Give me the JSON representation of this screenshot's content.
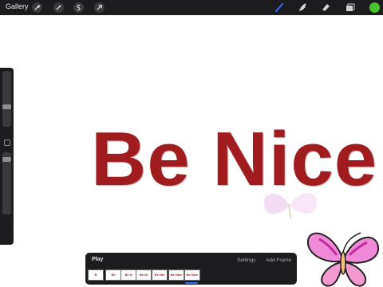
{
  "topbar": {
    "gallery_label": "Gallery",
    "left_tools": [
      "wrench-icon",
      "magic-wand-icon",
      "selection-icon",
      "transform-arrow-icon"
    ],
    "right_tools": [
      "brush-icon",
      "smudge-icon",
      "eraser-icon",
      "layers-icon"
    ],
    "active_tool": "brush-icon",
    "accent_color": "#2f6df6",
    "current_color": "#49c32c"
  },
  "sidebar": {
    "controls": [
      "brush-size-slider",
      "modify-button",
      "brush-opacity-slider"
    ]
  },
  "canvas": {
    "text": "Be Nice",
    "text_color": "#a11c1f"
  },
  "animation": {
    "play_label": "Play",
    "settings_label": "Settings",
    "add_frame_label": "Add Frame",
    "frames": [
      "B",
      "Be",
      "Be N",
      "Be Ni",
      "Be Nic",
      "Be Nice",
      "Be Nice"
    ]
  }
}
